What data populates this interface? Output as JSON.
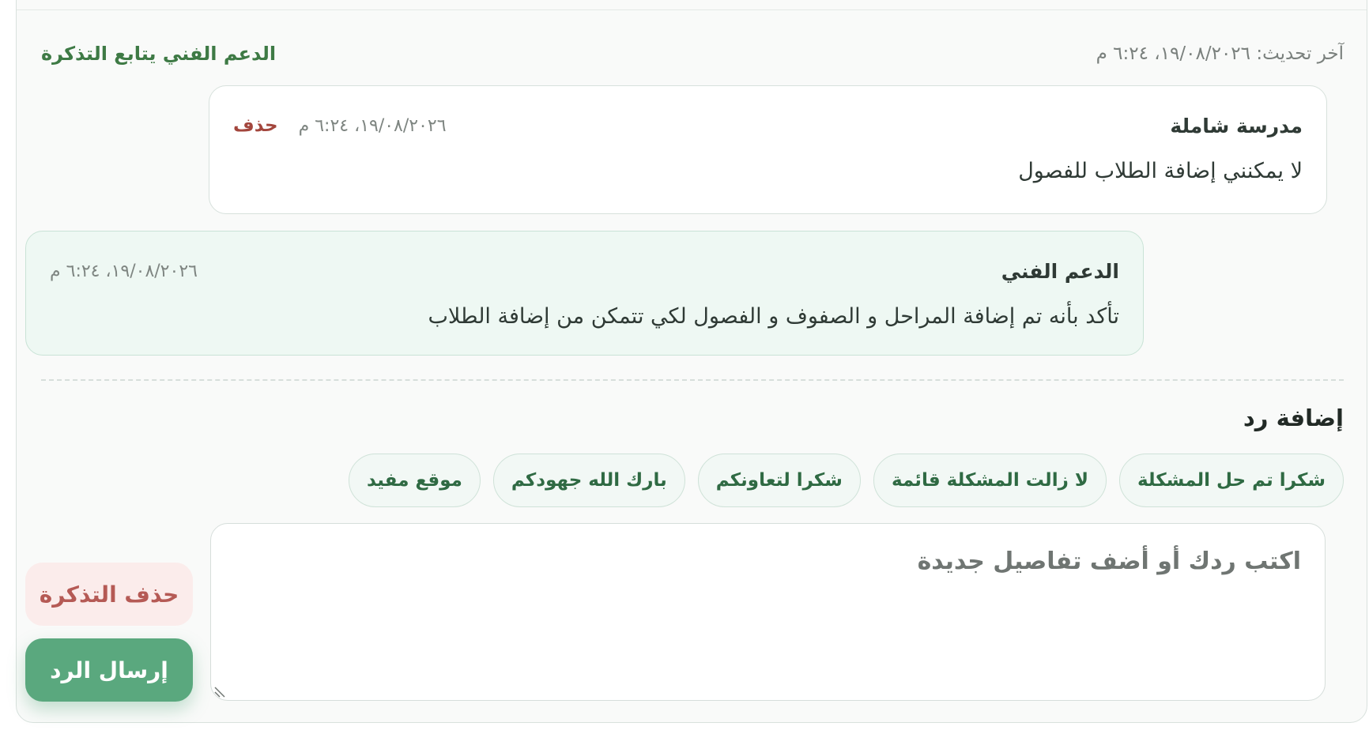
{
  "status": {
    "last_update": "آخر تحديث: ١٩/٠٨/٢٠٢٦، ٦:٢٤ م",
    "follow_label": "الدعم الفني يتابع التذكرة"
  },
  "messages": [
    {
      "author": "مدرسة شاملة",
      "time": "١٩/٠٨/٢٠٢٦، ٦:٢٤ م",
      "delete_label": "حذف",
      "body": "لا يمكنني إضافة الطلاب للفصول"
    },
    {
      "author": "الدعم الفني",
      "time": "١٩/٠٨/٢٠٢٦، ٦:٢٤ م",
      "body": "تأكد بأنه تم إضافة المراحل و الصفوف و الفصول لكي تتمكن من إضافة الطلاب"
    }
  ],
  "reply": {
    "title": "إضافة رد",
    "quick_replies": [
      "شكرا تم حل المشكلة",
      "لا زالت المشكلة قائمة",
      "شكرا لتعاونكم",
      "بارك الله جهودكم",
      "موقع مفيد"
    ],
    "placeholder": "اكتب ردك أو أضف تفاصيل جديدة",
    "delete_ticket_label": "حذف التذكرة",
    "send_label": "إرسال الرد"
  }
}
